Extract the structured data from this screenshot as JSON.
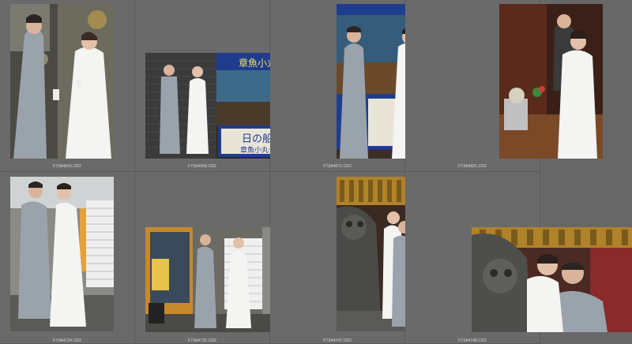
{
  "grid": {
    "thumbnails": [
      {
        "filename": "F73A4643.CR2",
        "scene": "street-window"
      },
      {
        "filename": "F73A4668.CR2",
        "scene": "food-stall-wide"
      },
      {
        "filename": "F73A4671.CR2",
        "scene": "food-stall-close"
      },
      {
        "filename": "F73A4681.CR2",
        "scene": "stall-counter"
      },
      {
        "filename": "F73A4724.CR2",
        "scene": "alley-embrace"
      },
      {
        "filename": "F73A4732.CR2",
        "scene": "alley-wide"
      },
      {
        "filename": "F73A4747.CR2",
        "scene": "temple-lion"
      },
      {
        "filename": "F73A4748.CR2",
        "scene": "temple-piggyback"
      }
    ]
  },
  "signage": {
    "stall_title": "日の船",
    "stall_subtitle": "章魚小丸子",
    "stall_top": "章魚小丸子"
  },
  "colors": {
    "background": "#676767",
    "cell_divider": "#5a5a5a",
    "filename_text": "#dcdcdc",
    "suit_grey": "#9aa3ab",
    "dress_white": "#f4f4f2",
    "stall_blue": "#1f3d8c"
  }
}
